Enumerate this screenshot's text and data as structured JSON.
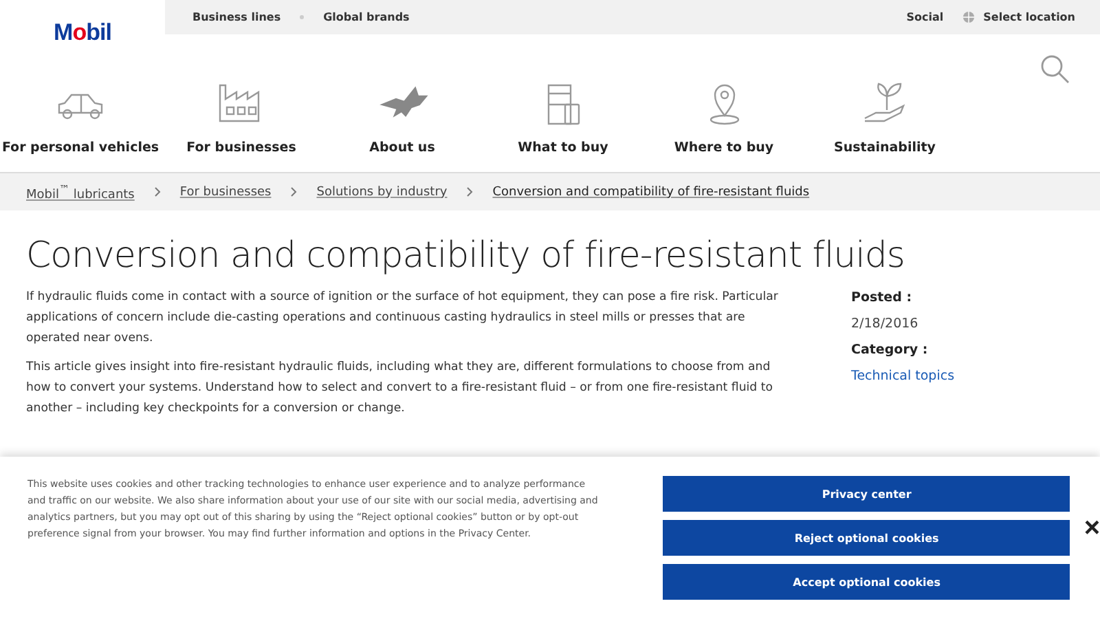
{
  "logo": "Mobil",
  "top_links": [
    "Business lines",
    "Global brands"
  ],
  "top_right": {
    "social": "Social",
    "location": "Select location"
  },
  "nav": [
    {
      "kind": "car",
      "label": "For personal vehicles"
    },
    {
      "kind": "factory",
      "label": "For businesses"
    },
    {
      "kind": "pegasus",
      "label": "About us"
    },
    {
      "kind": "barrel",
      "label": "What to buy"
    },
    {
      "kind": "pin",
      "label": "Where to buy"
    },
    {
      "kind": "plant",
      "label": "Sustainability"
    }
  ],
  "breadcrumb": [
    "Mobil$^{™}$ lubricants",
    "For businesses",
    "Solutions by industry",
    "Conversion and compatibility of fire-resistant fluids"
  ],
  "title": "Conversion and compatibility of fire-resistant fluids",
  "paragraphs": [
    "If hydraulic fluids come in contact with a source of ignition or the surface of hot equipment, they can pose a fire risk. Particular applications of concern include die-casting operations and continuous casting hydraulics in steel mills or presses that are operated near ovens.",
    "This article gives insight into fire-resistant hydraulic fluids, including what they are, different formulations to choose from and how to convert your systems. Understand how to select and convert to a fire-resistant fluid – or from one fire-resistant fluid to another – including key checkpoints for a conversion or change."
  ],
  "meta": {
    "posted_label": "Posted :",
    "posted": "2/18/2016",
    "category_label": "Category :",
    "category": "Technical topics"
  },
  "cookie_banner": {
    "text": "This website uses cookies and other tracking technologies to enhance user experience and to analyze performance and traffic on our website. We also share information about your use of our site with our social media, advertising and analytics partners, but you may opt out of this sharing by using the “Reject optional cookies” button or by opt-out preference signal from your browser. You may find further information and options in the Privacy Center.",
    "buttons": [
      "Privacy center",
      "Reject optional cookies",
      "Accept optional cookies"
    ],
    "close": "×"
  }
}
